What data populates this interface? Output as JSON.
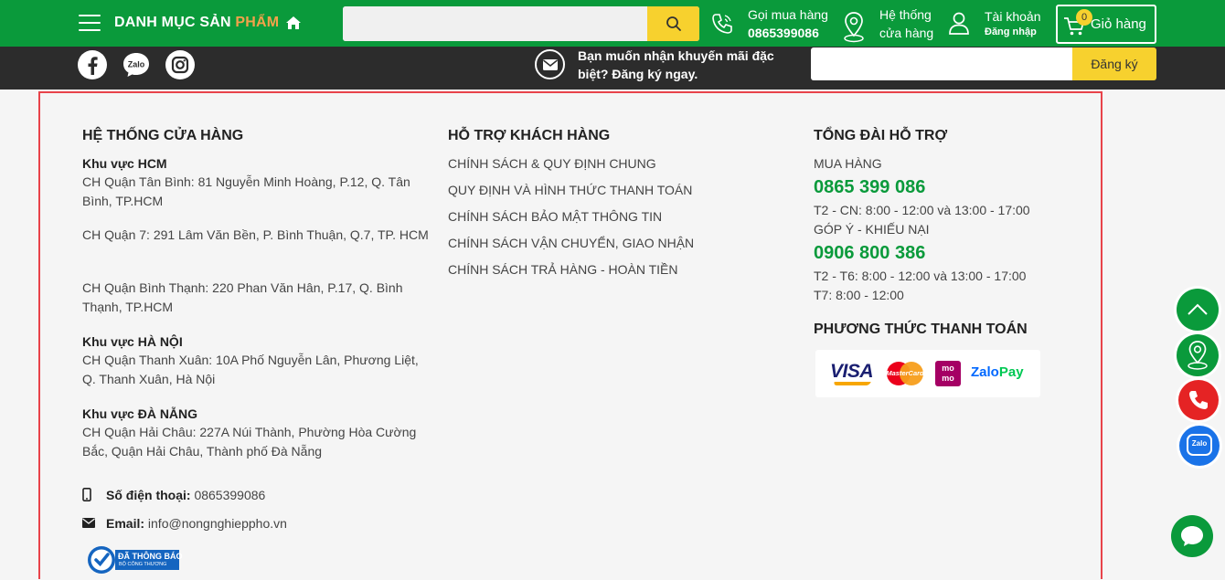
{
  "header": {
    "category_label_main": "DANH MỤC SẢN ",
    "category_label_accent": "PHẨM",
    "search_placeholder": "",
    "call_label": "Gọi mua hàng",
    "call_number": "0865399086",
    "stores_label_1": "Hệ thống",
    "stores_label_2": "cửa hàng",
    "account_label": "Tài khoản",
    "account_sub": "Đăng nhập",
    "cart_count": "0",
    "cart_label": "Giỏ hàng"
  },
  "newsletter": {
    "text": "Bạn muốn nhận khuyến mãi đặc biệt? Đăng ký ngay.",
    "input_placeholder": "",
    "button_label": "Đăng ký"
  },
  "footer": {
    "stores": {
      "title": "HỆ THỐNG CỬA HÀNG",
      "region_hcm": "Khu vực HCM",
      "hcm_1": "CH Quận Tân Bình: 81 Nguyễn Minh Hoàng, P.12, Q. Tân Bình, TP.HCM",
      "hcm_2": "CH Quận 7: 291 Lâm Văn Bền, P. Bình Thuận, Q.7, TP. HCM",
      "hcm_3": "CH Quận Bình Thạnh: 220 Phan Văn Hân, P.17, Q. Bình Thạnh, TP.HCM",
      "region_hn": "Khu vực HÀ NỘI",
      "hn_1": "CH Quận Thanh Xuân: 10A Phố Nguyễn Lân, Phương Liệt, Q. Thanh Xuân, Hà Nội",
      "region_dn": "Khu vực ĐÀ NẴNG",
      "dn_1": "CH Quận Hải Châu: 227A Núi Thành, Phường Hòa Cường Bắc, Quận Hải Châu, Thành phố Đà Nẵng",
      "phone_label": "Số điện thoại:",
      "phone_value": "0865399086",
      "email_label": "Email:",
      "email_value": "info@nongnghieppho.vn",
      "badge_line1": "ĐÃ THÔNG BÁO",
      "badge_line2": "BỘ CÔNG THƯƠNG"
    },
    "support": {
      "title": "HỖ TRỢ KHÁCH HÀNG",
      "links": [
        "CHÍNH SÁCH & QUY ĐỊNH CHUNG",
        "QUY ĐỊNH VÀ HÌNH THỨC THANH TOÁN",
        "CHÍNH SÁCH BẢO MẬT THÔNG TIN",
        "CHÍNH SÁCH VẬN CHUYỂN, GIAO NHẬN",
        "CHÍNH SÁCH TRẢ HÀNG - HOÀN TIỀN"
      ]
    },
    "hotline": {
      "title": "TỔNG ĐÀI HỖ TRỢ",
      "buy_label": "MUA HÀNG",
      "buy_number": "0865 399 086",
      "buy_hours": "T2 - CN: 8:00 - 12:00 và 13:00 - 17:00",
      "feedback_label": "GÓP Ý - KHIẾU NẠI",
      "feedback_number": "0906 800 386",
      "feedback_hours_1": "T2 - T6: 8:00 - 12:00 và 13:00 - 17:00",
      "feedback_hours_2": "T7: 8:00 - 12:00",
      "payment_title": "PHƯƠNG THỨC THANH TOÁN",
      "pay_visa": "VISA",
      "pay_master": "MasterCard",
      "pay_momo_1": "mo",
      "pay_momo_2": "mo",
      "pay_zalo_1": "Zalo",
      "pay_zalo_2": "Pay"
    }
  },
  "floating": {
    "zalo_label": "Zalo"
  },
  "colors": {
    "brand_green": "#0a9a3b",
    "accent_yellow": "#f7d12e",
    "highlight_red": "#e8434a"
  }
}
